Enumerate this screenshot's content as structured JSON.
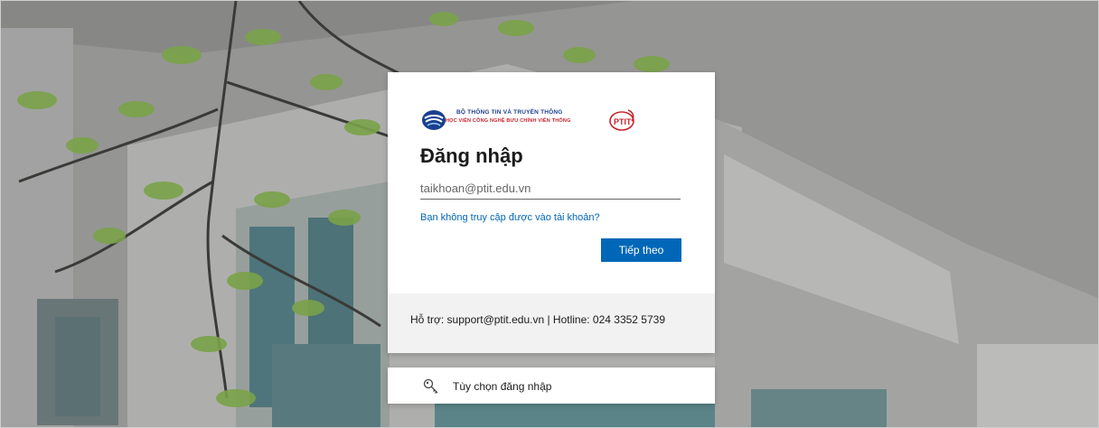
{
  "logo": {
    "line1": "BỘ THÔNG TIN VÀ TRUYỀN THÔNG",
    "line2": "HỌC VIỆN CÔNG NGHỆ BƯU CHÍNH VIỄN THÔNG",
    "emblem_text": "PTIT"
  },
  "signin": {
    "title": "Đăng nhập",
    "email_placeholder": "taikhoan@ptit.edu.vn",
    "email_value": "",
    "cant_access_link": "Bạn không truy cập được vào tài khoản?",
    "next_button": "Tiếp theo"
  },
  "footer": {
    "support_text": "Hỗ trợ: support@ptit.edu.vn | Hotline: 024 3352 5739"
  },
  "options": {
    "label": "Tùy chọn đăng nhập",
    "icon": "key-icon"
  },
  "colors": {
    "accent": "#0067b8",
    "footer_bg": "#f2f2f2",
    "logo_blue": "#1b3f8f",
    "logo_red": "#c8232c"
  }
}
